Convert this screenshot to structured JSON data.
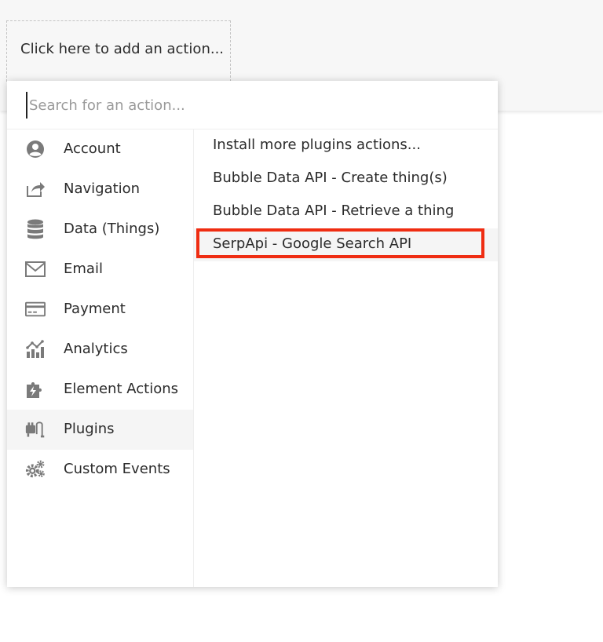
{
  "add_action": {
    "label": "Click here to add an action..."
  },
  "search": {
    "placeholder": "Search for an action...",
    "value": ""
  },
  "categories": [
    {
      "label": "Account",
      "icon": "user-circle-icon"
    },
    {
      "label": "Navigation",
      "icon": "share-arrow-icon"
    },
    {
      "label": "Data (Things)",
      "icon": "database-icon"
    },
    {
      "label": "Email",
      "icon": "envelope-icon"
    },
    {
      "label": "Payment",
      "icon": "credit-card-icon"
    },
    {
      "label": "Analytics",
      "icon": "analytics-chart-icon"
    },
    {
      "label": "Element Actions",
      "icon": "puzzle-bolt-icon"
    },
    {
      "label": "Plugins",
      "icon": "plug-icon",
      "active": true
    },
    {
      "label": "Custom Events",
      "icon": "gears-icon"
    }
  ],
  "actions": [
    {
      "label": "Install more plugins actions..."
    },
    {
      "label": "Bubble Data API - Create thing(s)"
    },
    {
      "label": "Bubble Data API - Retrieve a thing"
    },
    {
      "label": "SerpApi - Google Search API",
      "highlighted": true
    }
  ],
  "colors": {
    "highlight_border": "#ef2d12",
    "icon_gray": "#7a7a7a",
    "active_row_bg": "#f5f5f5"
  }
}
